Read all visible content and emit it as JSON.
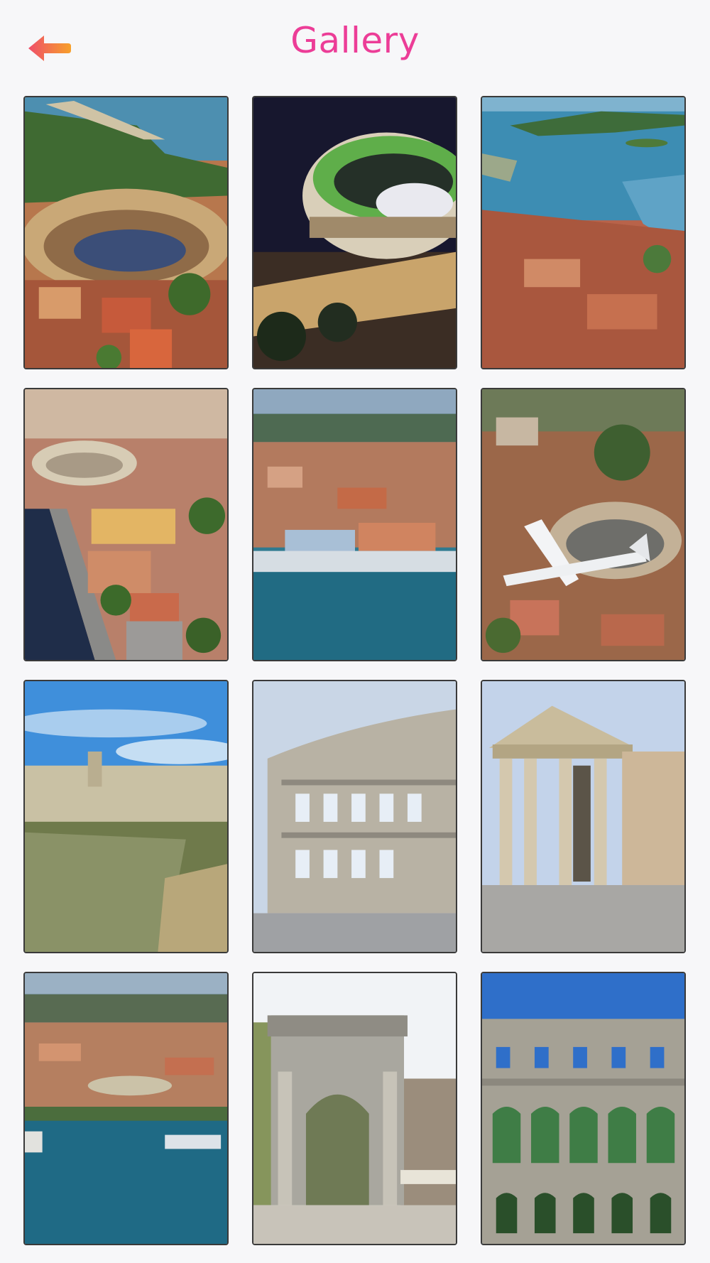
{
  "header": {
    "title": "Gallery",
    "back_icon": "arrow-left-icon",
    "title_color": "#ec3d97",
    "back_gradient": [
      "#ef4f6a",
      "#f7a02a"
    ]
  },
  "gallery": {
    "items": [
      {
        "id": "photo-1"
      },
      {
        "id": "photo-2"
      },
      {
        "id": "photo-3"
      },
      {
        "id": "photo-4"
      },
      {
        "id": "photo-5"
      },
      {
        "id": "photo-6"
      },
      {
        "id": "photo-7"
      },
      {
        "id": "photo-8"
      },
      {
        "id": "photo-9"
      },
      {
        "id": "photo-10"
      },
      {
        "id": "photo-11"
      },
      {
        "id": "photo-12"
      }
    ]
  }
}
